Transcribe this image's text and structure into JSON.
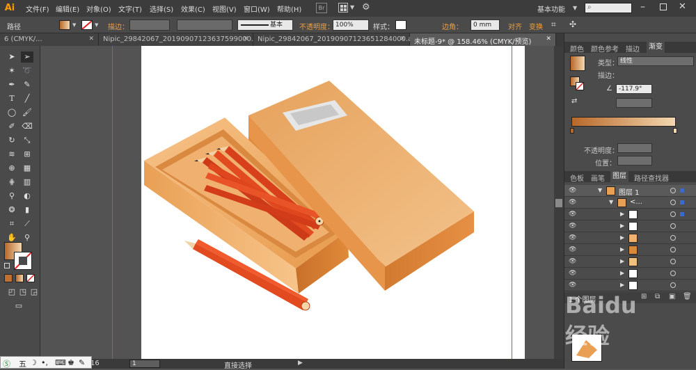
{
  "app": {
    "logo": "Ai"
  },
  "menubar": {
    "items": [
      "文件(F)",
      "编辑(E)",
      "对象(O)",
      "文字(T)",
      "选择(S)",
      "效果(C)",
      "视图(V)",
      "窗口(W)",
      "帮助(H)"
    ],
    "workspace": "基本功能",
    "bridge": "Br"
  },
  "controlbar": {
    "selection_type": "路径",
    "stroke_label": "描边：",
    "stroke_profile": "基本",
    "opacity_label": "不透明度：",
    "opacity_value": "100%",
    "style_label": "样式：",
    "corner_label": "边角：",
    "corner_value": "0 mm",
    "align_label": "对齐",
    "transform_label": "变换"
  },
  "tabs": [
    {
      "label": "6 (CMYK/...",
      "active": false
    },
    {
      "label": "Nipic_29842067_20190907123637599000.ai*",
      "active": false
    },
    {
      "label": "Nipic_29842067_20190907123651284000.ai*",
      "active": false
    },
    {
      "label": "未标题-9* @ 158.46% (CMYK/预览)",
      "active": true
    }
  ],
  "gradient_panel": {
    "tabs": [
      "颜色",
      "颜色参考",
      "描边",
      "渐变"
    ],
    "type_label": "类型：",
    "type_value": "线性",
    "stroke_label": "描边：",
    "angle_value": "-117.9°",
    "opacity_label": "不透明度：",
    "position_label": "位置："
  },
  "layers_panel": {
    "tabs": [
      "色板",
      "画笔",
      "图层",
      "路径查找器"
    ],
    "top_layer": "图层 1",
    "group_label": "<...",
    "footer": "1 个图层"
  },
  "statusbar": {
    "zoom": "16",
    "page": "1",
    "tool_name": "直接选择"
  },
  "ime": {
    "label": "五"
  },
  "colors": {
    "ai_orange": "#ff9a00",
    "gradient_start": "#b8682a",
    "gradient_end": "#f4d8b0",
    "guide": "#c8484c"
  },
  "watermark": {
    "text": "Baidu 经验"
  }
}
